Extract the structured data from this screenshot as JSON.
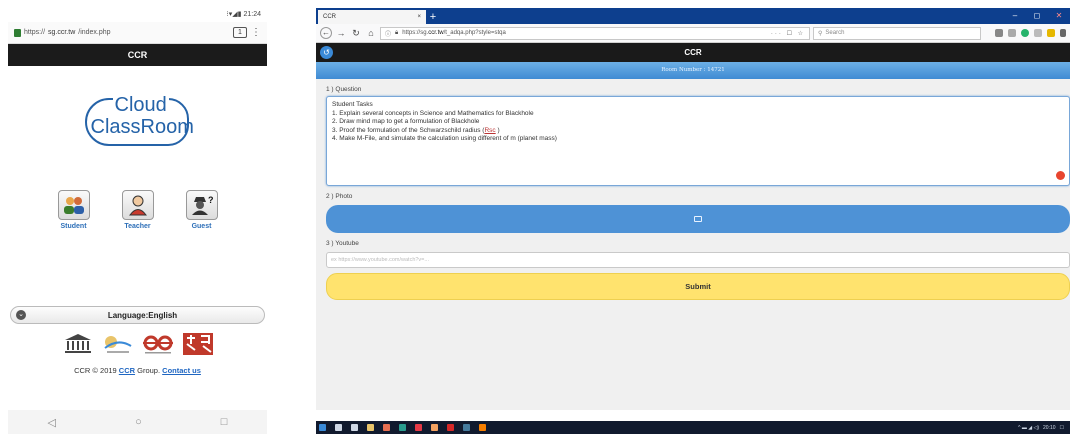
{
  "phone": {
    "status_time": "21:24",
    "url_prefix": "https://",
    "url_host": "sg.ccr.tw",
    "url_path": "/index.php",
    "tab_count": "1",
    "app_bar_title": "CCR",
    "logo_line1": "Cloud",
    "logo_line2": "ClassRoom",
    "roles": [
      {
        "label": "Student",
        "icon": "students-icon"
      },
      {
        "label": "Teacher",
        "icon": "teacher-icon"
      },
      {
        "label": "Guest",
        "icon": "guest-icon"
      }
    ],
    "language_label": "Language:English",
    "footer_prefix": "CCR © 2019 ",
    "footer_group_link": "CCR",
    "footer_mid": " Group. ",
    "footer_contact": "Contact us"
  },
  "browser": {
    "tab_title": "CCR",
    "url_prefix": "https://sg.",
    "url_host": "ccr.tw",
    "url_path": "/t_adqa.php?style=stqa",
    "url_actions": "··· ☐ ☆",
    "search_placeholder": "Search"
  },
  "app": {
    "title": "CCR",
    "room_number": "Room Number : 14721",
    "question_label": "1 ) Question",
    "question_lines": {
      "l0": "Student Tasks",
      "l1": "1. Explain several concepts in Science and Mathematics for Blackhole",
      "l2": "2. Draw mind map to get a formulation of Blackhole",
      "l3_before": "3. Proof the formulation of the Schwarzschild radius (",
      "l3_ul": "Rsc",
      "l3_after": " )",
      "l4": "4. Make M-File, and simulate the calculation using different of m (planet mass)"
    },
    "photo_label": "2 ) Photo",
    "youtube_label": "3 ) Youtube",
    "youtube_placeholder": "ex https://www.youtube.com/watch?v=...",
    "submit_label": "Submit",
    "tray_time": "20:10"
  },
  "colors": {
    "accent_blue": "#4e92d6",
    "submit_yellow": "#ffe36e",
    "header_dark": "#1a1a1a",
    "browser_blue": "#0d3f8e"
  }
}
